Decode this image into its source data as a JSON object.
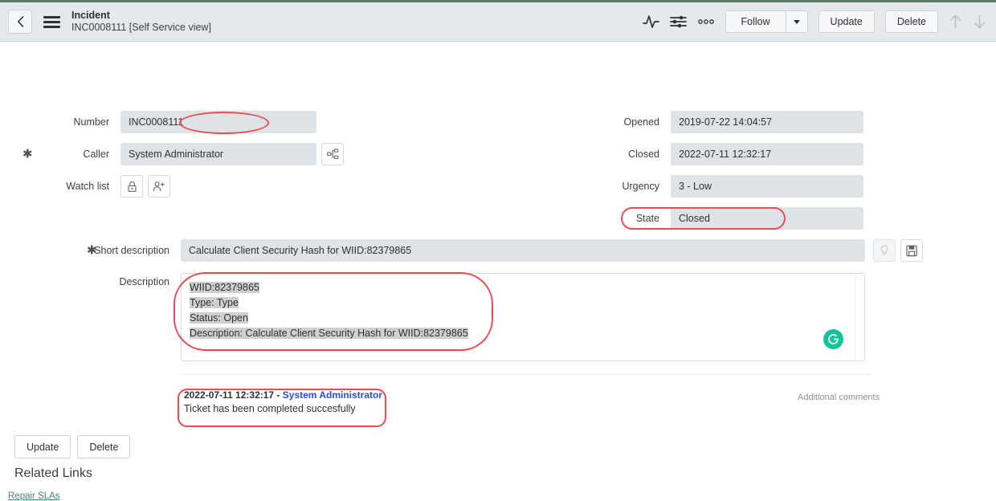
{
  "header": {
    "back_icon": "chevron-left-icon",
    "menu_icon": "hamburger-icon",
    "title": "Incident",
    "subtitle": "INC0008111 [Self Service view]",
    "activity_icon": "activity-chart-icon",
    "filter_icon": "sliders-icon",
    "more_icon": "more-dots-icon",
    "follow_label": "Follow",
    "follow_caret": "chevron-down-icon",
    "update_label": "Update",
    "delete_label": "Delete",
    "prev_icon": "arrow-up-icon",
    "next_icon": "arrow-down-icon"
  },
  "form": {
    "left": [
      {
        "label": "Number",
        "value": "INC0008111",
        "required": false,
        "annotated": true
      },
      {
        "label": "Caller",
        "value": "System Administrator",
        "required": true,
        "icon": "org-chart-icon"
      },
      {
        "label": "Watch list",
        "value": "",
        "required": false,
        "icons": [
          "lock-icon",
          "add-user-icon"
        ]
      }
    ],
    "right": [
      {
        "label": "Opened",
        "value": "2019-07-22 14:04:57"
      },
      {
        "label": "Closed",
        "value": "2022-07-11 12:32:17"
      },
      {
        "label": "Urgency",
        "value": "3 - Low"
      },
      {
        "label": "State",
        "value": "Closed",
        "annotated": true
      }
    ],
    "short_description": {
      "label": "Short description",
      "value": "Calculate Client Security Hash for WIID:82379865",
      "required": true,
      "hint_icon": "lightbulb-icon",
      "template_icon": "save-template-icon"
    },
    "description": {
      "label": "Description",
      "lines": [
        "WIID:82379865",
        "Type: Type",
        "Status: Open",
        "Description: Calculate Client Security Hash for WIID:82379865"
      ],
      "grammarly_icon": "grammarly-icon",
      "grammarly_letter": "G"
    }
  },
  "activity": {
    "additional_comments_label": "Additional comments",
    "entry": {
      "timestamp": "2022-07-11 12:32:17",
      "separator": " - ",
      "author": "System Administrator",
      "text": "Ticket has been completed succesfully"
    }
  },
  "footer": {
    "update_label": "Update",
    "delete_label": "Delete",
    "related_links_title": "Related Links",
    "related_links": [
      {
        "label": "Repair SLAs"
      }
    ]
  },
  "colors": {
    "header_bg": "#e4eaec",
    "top_band": "#5b7a6a",
    "field_bg": "#dde3e6",
    "annotation": "#f04a52",
    "link_green": "#3d8b6d",
    "author_blue": "#2a4ed8",
    "grammarly_green": "#15c39a",
    "highlight_gray": "#cfcfcf"
  }
}
